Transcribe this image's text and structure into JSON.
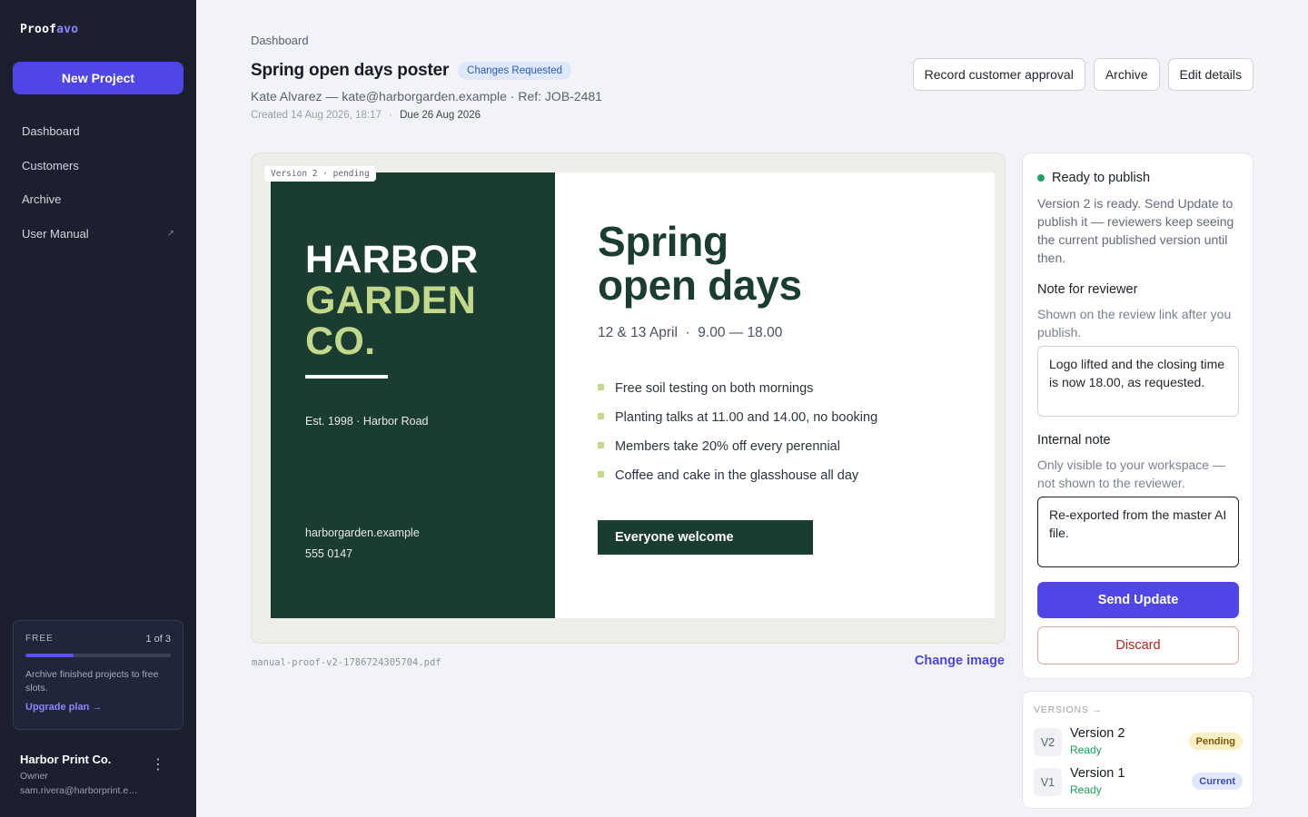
{
  "app": {
    "logo_main": "Proof",
    "logo_accent": "avo",
    "new_project_label": "New Project"
  },
  "sidebar": {
    "items": [
      {
        "label": "Dashboard"
      },
      {
        "label": "Customers"
      },
      {
        "label": "Archive"
      },
      {
        "label": "User Manual",
        "external_icon": "↗"
      }
    ],
    "plan": {
      "tier": "FREE",
      "count": "1 of 3",
      "usage_fraction": 0.33,
      "text": "Archive finished projects to free slots.",
      "link": "Upgrade plan →"
    },
    "account": {
      "name": "Harbor Print Co.",
      "role": "Owner",
      "email": "sam.rivera@harborprint.example"
    }
  },
  "header": {
    "breadcrumb": "Dashboard",
    "title": "Spring open days poster",
    "status": "Changes Requested",
    "meta": "Kate Alvarez — kate@harborgarden.example · Ref: JOB-2481",
    "created": "Created 14 Aug 2026, 18:17",
    "separator": "·",
    "due": "Due 26 Aug 2026",
    "actions": {
      "record": "Record customer approval",
      "archive": "Archive",
      "edit": "Edit details"
    }
  },
  "preview": {
    "version_tag": "Version 2 · pending",
    "file_name": "manual-proof-v2-1786724305704.pdf",
    "change_image": "Change image",
    "poster": {
      "brand_line1": "HARBOR",
      "brand_line2": "GARDEN",
      "brand_line3": "CO.",
      "est": "Est. 1998 · Harbor Road",
      "web": "harborgarden.example",
      "tel": "555 0147",
      "title_line1": "Spring",
      "title_line2": "open days",
      "date": "12 & 13 April  ·  9.00 — 18.00",
      "features": [
        "Free soil testing on both mornings",
        "Planting talks at 11.00 and 14.00, no booking",
        "Members take 20% off every perennial",
        "Coffee and cake in the glasshouse all day"
      ],
      "cta": "Everyone welcome"
    }
  },
  "panel": {
    "ready_title": "Ready to publish",
    "ready_text": "Version 2 is ready. Send Update to publish it — reviewers keep seeing the current published version until then.",
    "reviewer_label": "Note for reviewer",
    "reviewer_help": "Shown on the review link after you publish.",
    "reviewer_value": "Logo lifted and the closing time is now 18.00, as requested.",
    "internal_label": "Internal note",
    "internal_help": "Only visible to your workspace — not shown to the reviewer.",
    "internal_value": "Re-exported from the master AI file.",
    "send": "Send Update",
    "discard": "Discard"
  },
  "versions": {
    "heading": "VERSIONS →",
    "items": [
      {
        "chip": "V2",
        "name": "Version 2",
        "status": "Ready",
        "badge": "Pending"
      },
      {
        "chip": "V1",
        "name": "Version 1",
        "status": "Ready",
        "badge": "Current"
      }
    ]
  },
  "colors": {
    "accent": "#5046e5",
    "sidebar_bg": "#1b1f2e",
    "poster_green": "#1b3c30",
    "poster_lime": "#c2d98c",
    "ready_green": "#1fa463",
    "danger": "#b3261e"
  }
}
